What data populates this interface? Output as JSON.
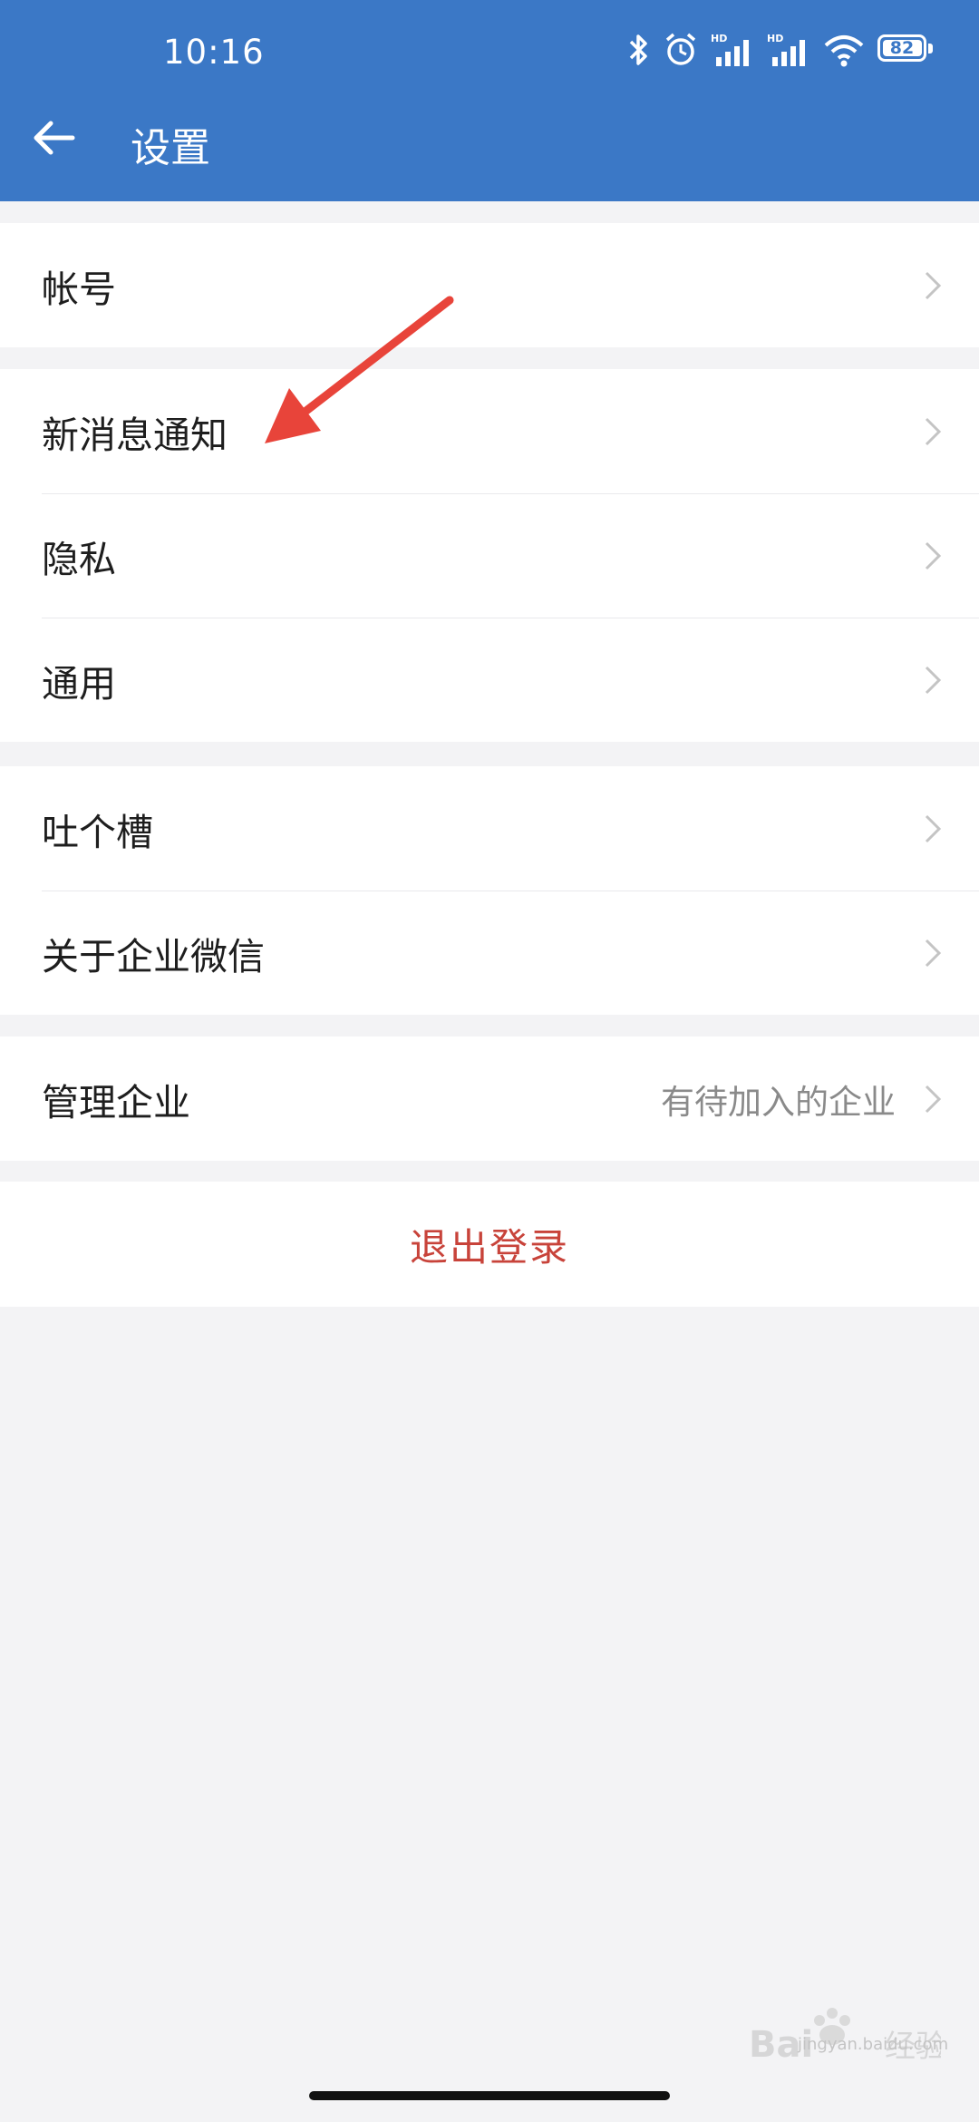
{
  "status_bar": {
    "time": "10:16",
    "battery": "82",
    "icons": [
      "bluetooth-icon",
      "alarm-icon",
      "signal-hd-icon",
      "signal-hd-icon",
      "wifi-icon",
      "battery-icon"
    ]
  },
  "header": {
    "back_icon": "arrow-left-icon",
    "title": "设置"
  },
  "groups": [
    {
      "items": [
        {
          "label": "帐号"
        }
      ]
    },
    {
      "items": [
        {
          "label": "新消息通知"
        },
        {
          "label": "隐私"
        },
        {
          "label": "通用"
        }
      ]
    },
    {
      "items": [
        {
          "label": "吐个槽"
        },
        {
          "label": "关于企业微信"
        }
      ]
    },
    {
      "items": [
        {
          "label": "管理企业",
          "value": "有待加入的企业"
        }
      ]
    }
  ],
  "logout": {
    "label": "退出登录"
  },
  "colors": {
    "header_bg": "#3b78c6",
    "page_bg": "#f3f3f5",
    "logout_text": "#c8433a",
    "annotation_arrow": "#e8443a"
  },
  "watermark": {
    "text": "jingyan.baidu.com"
  }
}
